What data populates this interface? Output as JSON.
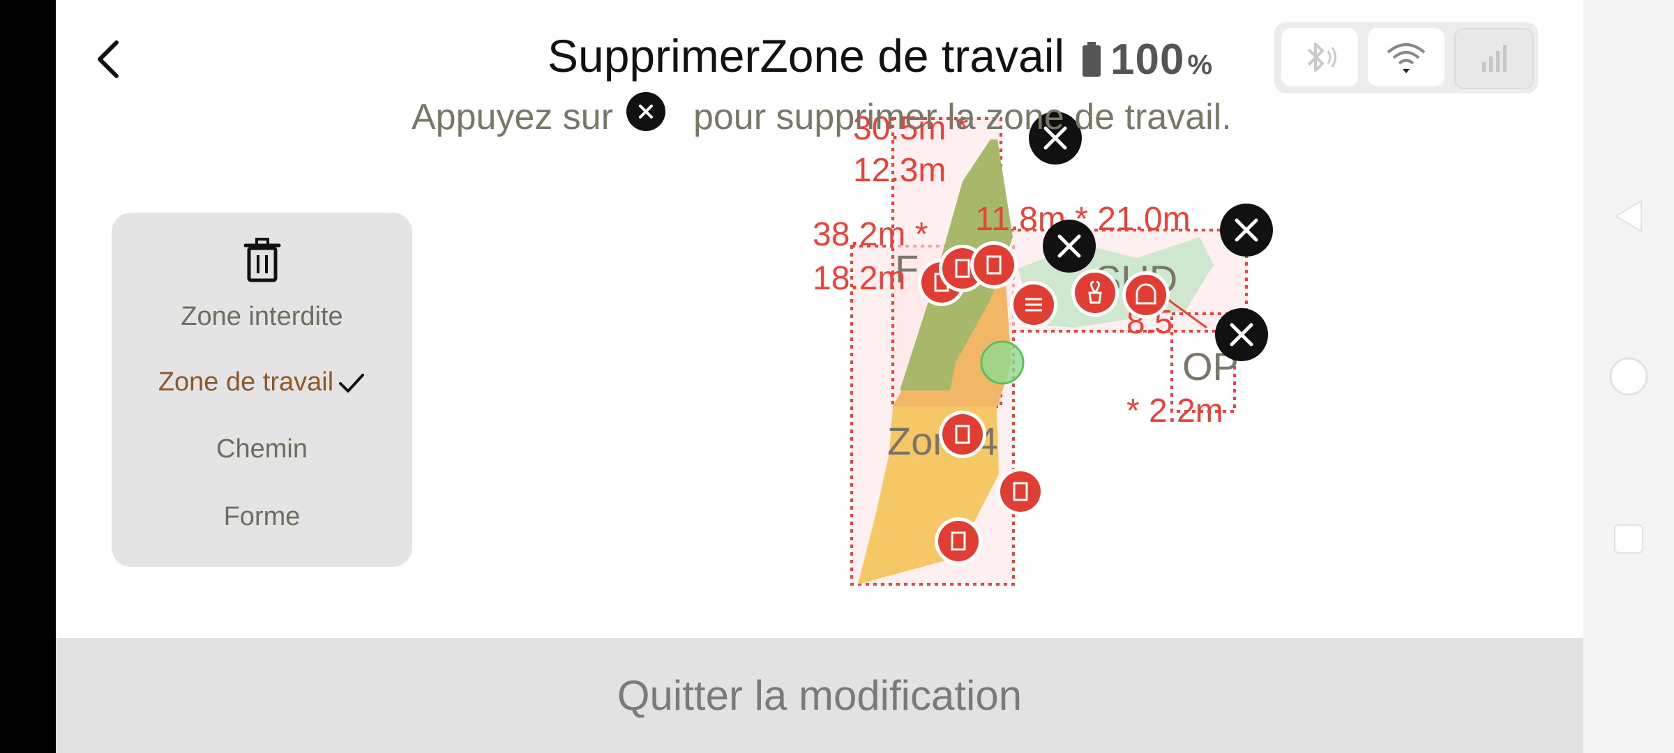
{
  "header": {
    "title": "SupprimerZone de travail",
    "battery_percent": "100",
    "battery_unit": "%",
    "hint_before": "Appuyez sur",
    "hint_after": "pour supprimer la zone de travail."
  },
  "status_icons": [
    "bluetooth-icon",
    "wifi-icon",
    "cellular-signal-icon"
  ],
  "menu": {
    "icon": "trash-icon",
    "items": [
      {
        "label": "Zone interdite",
        "active": false
      },
      {
        "label": "Zone de travail",
        "active": true
      },
      {
        "label": "Chemin",
        "active": false
      },
      {
        "label": "Forme",
        "active": false
      }
    ]
  },
  "map": {
    "zone_labels": [
      "F",
      "SUD",
      "OP",
      "Zone4"
    ],
    "dimension_labels": [
      {
        "line1": "30.5m *",
        "line2": "12.3m"
      },
      {
        "line1": "38.2m *",
        "line2": "18.2m"
      },
      {
        "line1": "11.8m * 21.0m",
        "line2": ""
      },
      {
        "line1": "8.5",
        "line2": "* 2.2m"
      }
    ],
    "colors": {
      "dim_text": "#e8433a",
      "zone_fill_green": "#cfe7cf",
      "zone_fill_yellow": "#f6c765",
      "zone_fill_olive": "#a7b86a"
    }
  },
  "footer": {
    "quit_label": "Quitter la modification"
  }
}
